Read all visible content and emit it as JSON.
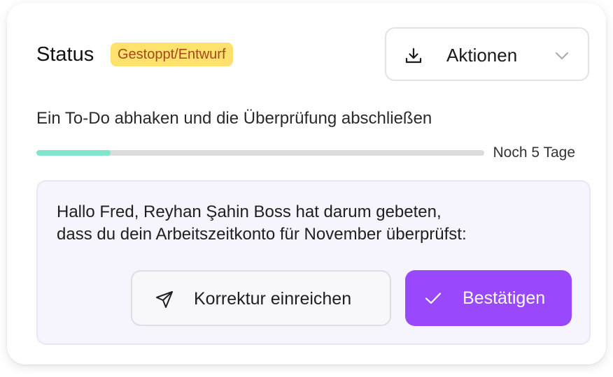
{
  "status": {
    "label": "Status",
    "badge": "Gestoppt/Entwurf",
    "badge_bg_color": "#ffe26e",
    "badge_text_color": "#a4471a"
  },
  "actions": {
    "label": "Aktionen",
    "icon": "download-icon",
    "dropdown_icon": "chevron-down-icon"
  },
  "task": {
    "text": "Ein To-Do abhaken und die Überprüfung abschließen",
    "progress_fraction": 0.165,
    "progress_color": "#7fe6cc",
    "remaining": "Noch 5 Tage"
  },
  "request": {
    "line1": "Hallo Fred, Reyhan Şahin Boss hat darum gebeten,",
    "line2": "dass du dein Arbeitszeitkonto für November überprüfst:",
    "correction_button": {
      "label": "Korrektur einreichen",
      "icon": "send-icon"
    },
    "confirm_button": {
      "label": "Bestätigen",
      "icon": "check-icon",
      "color": "#9a48fb"
    }
  }
}
